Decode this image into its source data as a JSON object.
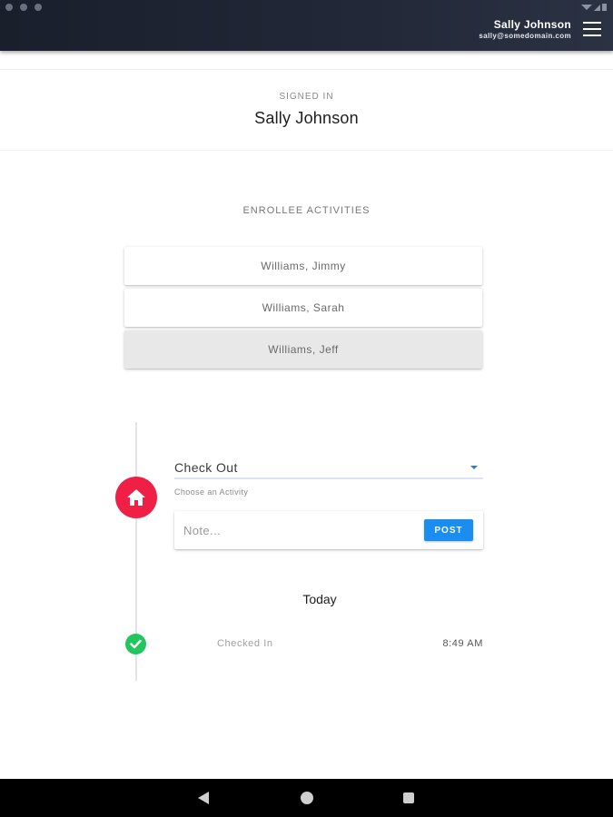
{
  "header": {
    "user_name": "Sally Johnson",
    "user_email": "sally@somedomain.com"
  },
  "signed_in": {
    "label": "SIGNED IN",
    "name": "Sally Johnson"
  },
  "enrollees": {
    "title": "ENROLLEE ACTIVITIES",
    "items": [
      {
        "name": "Williams, Jimmy",
        "selected": false
      },
      {
        "name": "Williams, Sarah",
        "selected": false
      },
      {
        "name": "Williams, Jeff",
        "selected": true
      }
    ]
  },
  "activity": {
    "selected": "Check Out",
    "helper": "Choose an Activity"
  },
  "note": {
    "placeholder": "Note...",
    "post_label": "POST"
  },
  "timeline": {
    "day": "Today",
    "events": [
      {
        "label": "Checked In",
        "time": "8:49 AM",
        "icon": "check-icon"
      }
    ]
  },
  "colors": {
    "accent_red": "#ef1f45",
    "post_blue": "#1a8ef0",
    "check_green": "#22c55e"
  }
}
